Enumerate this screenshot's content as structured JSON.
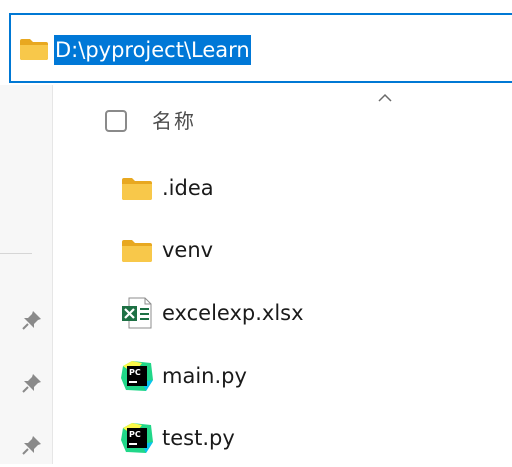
{
  "address_bar": {
    "path": "D:\\pyproject\\Learn",
    "icon": "folder-icon"
  },
  "navigation": {
    "pins": [
      "pin-icon",
      "pin-icon",
      "pin-icon"
    ]
  },
  "column_header": {
    "name_label": "名称",
    "sort_icon": "chevron-up-icon"
  },
  "files": [
    {
      "name": ".idea",
      "icon": "folder-icon"
    },
    {
      "name": "venv",
      "icon": "folder-icon"
    },
    {
      "name": "excelexp.xlsx",
      "icon": "excel-file-icon"
    },
    {
      "name": "main.py",
      "icon": "pycharm-file-icon"
    },
    {
      "name": "test.py",
      "icon": "pycharm-file-icon"
    }
  ],
  "colors": {
    "accent": "#0078d4",
    "selection": "#0078d7",
    "folder": "#f8c84a",
    "excel": "#1d7044",
    "pycharm": "#21d789"
  }
}
